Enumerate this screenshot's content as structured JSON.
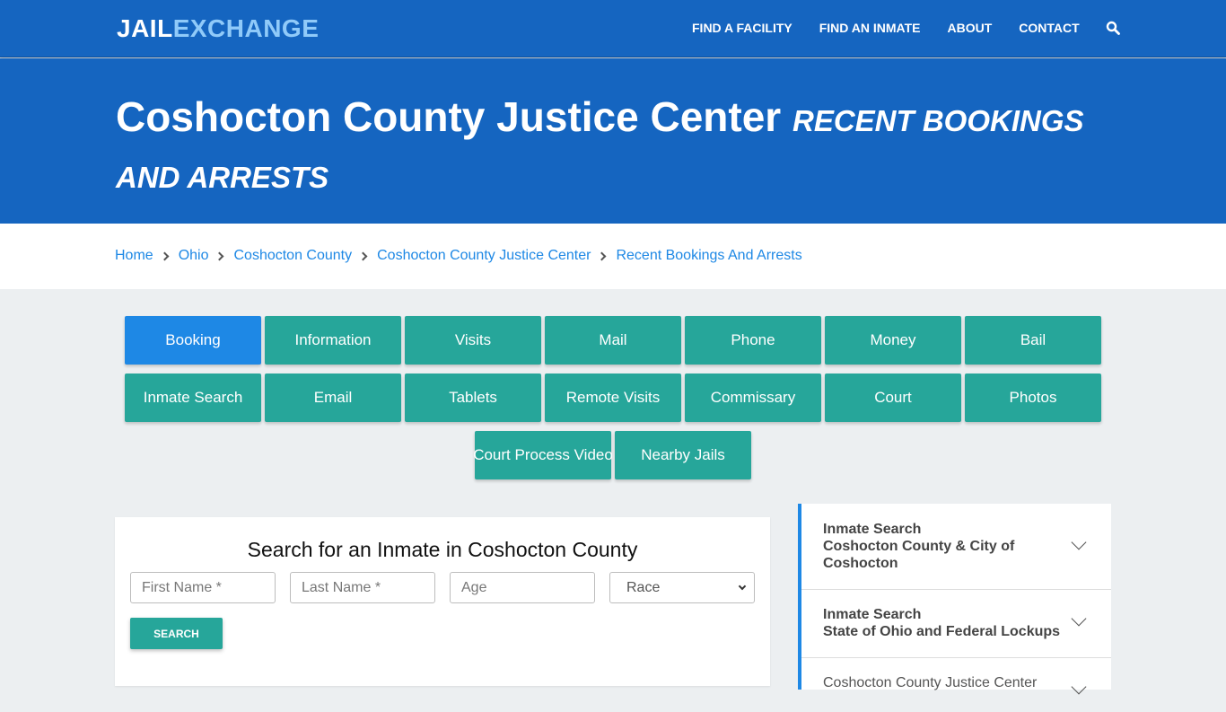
{
  "header": {
    "logo_part1": "JAIL",
    "logo_part2": "EXCHANGE",
    "nav": [
      "FIND A FACILITY",
      "FIND AN INMATE",
      "ABOUT",
      "CONTACT"
    ],
    "search_icon": "search-icon"
  },
  "hero": {
    "title": "Coshocton County Justice Center",
    "subtitle": "RECENT BOOKINGS AND ARRESTS"
  },
  "breadcrumb": [
    "Home",
    "Ohio",
    "Coshocton County",
    "Coshocton County Justice Center",
    "Recent Bookings And Arrests"
  ],
  "tabs": {
    "active": "Booking",
    "row1": [
      "Booking",
      "Information",
      "Visits",
      "Mail",
      "Phone",
      "Money",
      "Bail"
    ],
    "row2": [
      "Inmate Search",
      "Email",
      "Tablets",
      "Remote Visits",
      "Commissary",
      "Court",
      "Photos"
    ],
    "row3": [
      "Court Process Video",
      "Nearby Jails"
    ]
  },
  "search": {
    "title": "Search for an Inmate in Coshocton County",
    "first_name_placeholder": "First Name *",
    "last_name_placeholder": "Last Name *",
    "age_placeholder": "Age",
    "race_selected": "Race",
    "button": "SEARCH"
  },
  "sidebar": {
    "items": [
      {
        "line1": "Inmate Search",
        "line2": "Coshocton County & City of",
        "line3": "Coshocton"
      },
      {
        "line1": "Inmate Search",
        "line2": "State of Ohio and Federal Lockups"
      },
      {
        "line1": "Coshocton County Justice Center"
      }
    ]
  },
  "colors": {
    "brand_blue": "#1565c0",
    "accent_blue": "#1e88e5",
    "teal": "#26a69a",
    "logo_light": "#90caf9"
  }
}
